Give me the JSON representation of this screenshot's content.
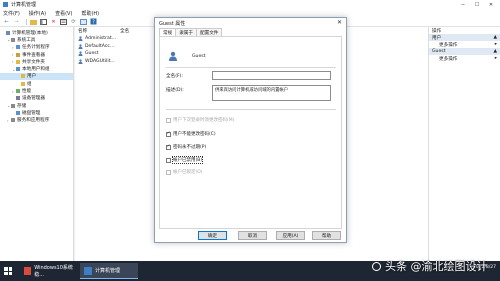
{
  "window": {
    "title": "计算机管理"
  },
  "menu": [
    "文件(F)",
    "操作(A)",
    "查看(V)",
    "帮助(H)"
  ],
  "tree": [
    {
      "label": "计算机管理(本地)",
      "level": 0,
      "twisty": "",
      "color": "#6a8bb5"
    },
    {
      "label": "系统工具",
      "level": 1,
      "twisty": "⌄",
      "color": "#8a8a8a"
    },
    {
      "label": "任务计划程序",
      "level": 2,
      "twisty": "›",
      "color": "#5a8fd0"
    },
    {
      "label": "事件查看器",
      "level": 2,
      "twisty": "›",
      "color": "#c9a13a"
    },
    {
      "label": "共享文件夹",
      "level": 2,
      "twisty": "›",
      "color": "#e2b84a"
    },
    {
      "label": "本地用户和组",
      "level": 2,
      "twisty": "⌄",
      "color": "#5a8fd0"
    },
    {
      "label": "用户",
      "level": 3,
      "twisty": "",
      "color": "#e2b84a",
      "selected": true
    },
    {
      "label": "组",
      "level": 3,
      "twisty": "",
      "color": "#e2b84a"
    },
    {
      "label": "性能",
      "level": 2,
      "twisty": "›",
      "color": "#6fae5e"
    },
    {
      "label": "设备管理器",
      "level": 2,
      "twisty": "",
      "color": "#7a7a9a"
    },
    {
      "label": "存储",
      "level": 1,
      "twisty": "⌄",
      "color": "#8a8a8a"
    },
    {
      "label": "磁盘管理",
      "level": 2,
      "twisty": "",
      "color": "#5a8fd0"
    },
    {
      "label": "服务和应用程序",
      "level": 1,
      "twisty": "›",
      "color": "#8a8a8a"
    }
  ],
  "list": {
    "headers": [
      "名称",
      "全名"
    ],
    "rows": [
      "Administrat...",
      "DefaultAcc...",
      "Guest",
      "WDAGUtilit..."
    ]
  },
  "actions": {
    "title": "操作",
    "groups": [
      {
        "label": "用户",
        "items": [
          "更多操作"
        ]
      },
      {
        "label": "Guest",
        "items": [
          "更多操作"
        ]
      }
    ]
  },
  "dialog": {
    "title": "Guest 属性",
    "tabs": [
      "常规",
      "隶属于",
      "配置文件"
    ],
    "username": "Guest",
    "fullname_label": "全名(F):",
    "fullname_value": "",
    "description_label": "描述(D):",
    "description_value": "供来宾访问计算机或访问域的内置帐户",
    "checkboxes": [
      {
        "label": "用户下次登录时须更改密码(M)",
        "checked": false,
        "disabled": true,
        "focus": false
      },
      {
        "label": "用户不能更改密码(C)",
        "checked": true,
        "disabled": false,
        "focus": false
      },
      {
        "label": "密码永不过期(P)",
        "checked": true,
        "disabled": false,
        "focus": false
      },
      {
        "label": "帐户已禁用(B)",
        "checked": false,
        "disabled": false,
        "focus": true
      },
      {
        "label": "帐户已锁定(O)",
        "checked": false,
        "disabled": true,
        "focus": false
      }
    ],
    "buttons": [
      "确定",
      "取消",
      "应用(A)",
      "帮助"
    ]
  },
  "taskbar": {
    "items": [
      {
        "label": "Windows10系统稳...",
        "active": false
      },
      {
        "label": "计算机管理",
        "active": true
      }
    ],
    "time": "",
    "date": "2022/8/27"
  },
  "watermark": "头条 @渝北绘图设计",
  "colors": {
    "accent": "#0078d7",
    "selection": "#cce4f7",
    "taskbar": "#1e2633"
  }
}
